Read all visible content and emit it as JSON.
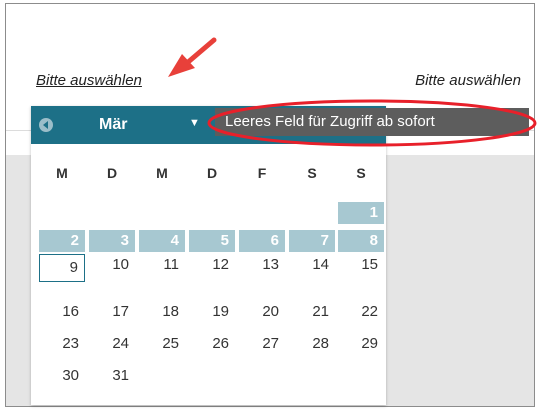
{
  "links": {
    "left": "Bitte auswählen",
    "right": "Bitte auswählen"
  },
  "calendar": {
    "month": "Mär",
    "prev_icon": "circle-left-arrow-icon",
    "caret_icon": "caret-down-icon",
    "weekdays": [
      "M",
      "D",
      "M",
      "D",
      "F",
      "S",
      "S"
    ],
    "weeks": [
      [
        "",
        "",
        "",
        "",
        "",
        "",
        "1"
      ],
      [
        "2",
        "3",
        "4",
        "5",
        "6",
        "7",
        "8"
      ],
      [
        "9",
        "10",
        "11",
        "12",
        "13",
        "14",
        "15"
      ],
      [
        "16",
        "17",
        "18",
        "19",
        "20",
        "21",
        "22"
      ],
      [
        "23",
        "24",
        "25",
        "26",
        "27",
        "28",
        "29"
      ],
      [
        "30",
        "31",
        "",
        "",
        "",
        "",
        ""
      ]
    ],
    "today": "9",
    "colors": {
      "header": "#1d7087",
      "highlight": "#a7c8d1"
    }
  },
  "tooltip": {
    "text": "Leeres Feld für Zugriff ab sofort"
  },
  "annotations": {
    "arrow_color": "#e8403a",
    "ellipse_color": "#e8202a"
  }
}
